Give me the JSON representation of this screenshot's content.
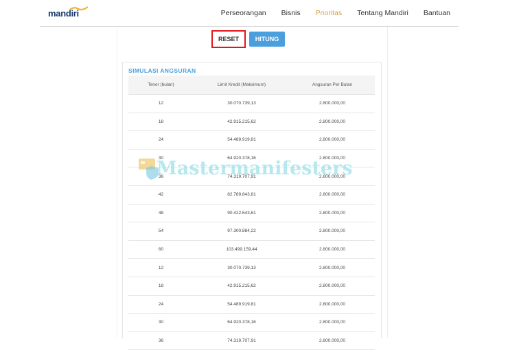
{
  "header": {
    "logo_text": "mandiri",
    "nav": [
      {
        "label": "Perseorangan",
        "active": false
      },
      {
        "label": "Bisnis",
        "active": false
      },
      {
        "label": "Prioritas",
        "active": true
      },
      {
        "label": "Tentang Mandiri",
        "active": false
      },
      {
        "label": "Bantuan",
        "active": false
      }
    ]
  },
  "actions": {
    "reset_label": "RESET",
    "hitung_label": "HITUNG"
  },
  "simulation": {
    "title": "SIMULASI ANGSURAN",
    "columns": [
      "Tenor (bulan)",
      "Limit Kredit (Maksimum)",
      "Angsuran Per Bulan"
    ],
    "rows": [
      [
        "12",
        "30.070.739,13",
        "2.800.000,00"
      ],
      [
        "18",
        "42.915.215,62",
        "2.800.000,00"
      ],
      [
        "24",
        "54.489.919,81",
        "2.800.000,00"
      ],
      [
        "30",
        "64.920.378,16",
        "2.800.000,00"
      ],
      [
        "36",
        "74.319.707,91",
        "2.800.000,00"
      ],
      [
        "42",
        "82.789.843,81",
        "2.800.000,00"
      ],
      [
        "48",
        "90.422.643,61",
        "2.800.000,00"
      ],
      [
        "54",
        "97.300.884,22",
        "2.800.000,00"
      ],
      [
        "60",
        "103.499.159,44",
        "2.800.000,00"
      ],
      [
        "12",
        "30.070.739,13",
        "2.800.000,00"
      ],
      [
        "18",
        "42.915.215,62",
        "2.800.000,00"
      ],
      [
        "24",
        "54.489.919,81",
        "2.800.000,00"
      ],
      [
        "30",
        "64.920.378,16",
        "2.800.000,00"
      ],
      [
        "36",
        "74.319.707,91",
        "2.800.000,00"
      ]
    ]
  },
  "watermark": {
    "text": "Mastermanifesters"
  },
  "colors": {
    "brand_blue": "#16386e",
    "accent_gold": "#d4a44a",
    "button_blue": "#4a9fdc",
    "highlight_red": "#e3151a"
  }
}
